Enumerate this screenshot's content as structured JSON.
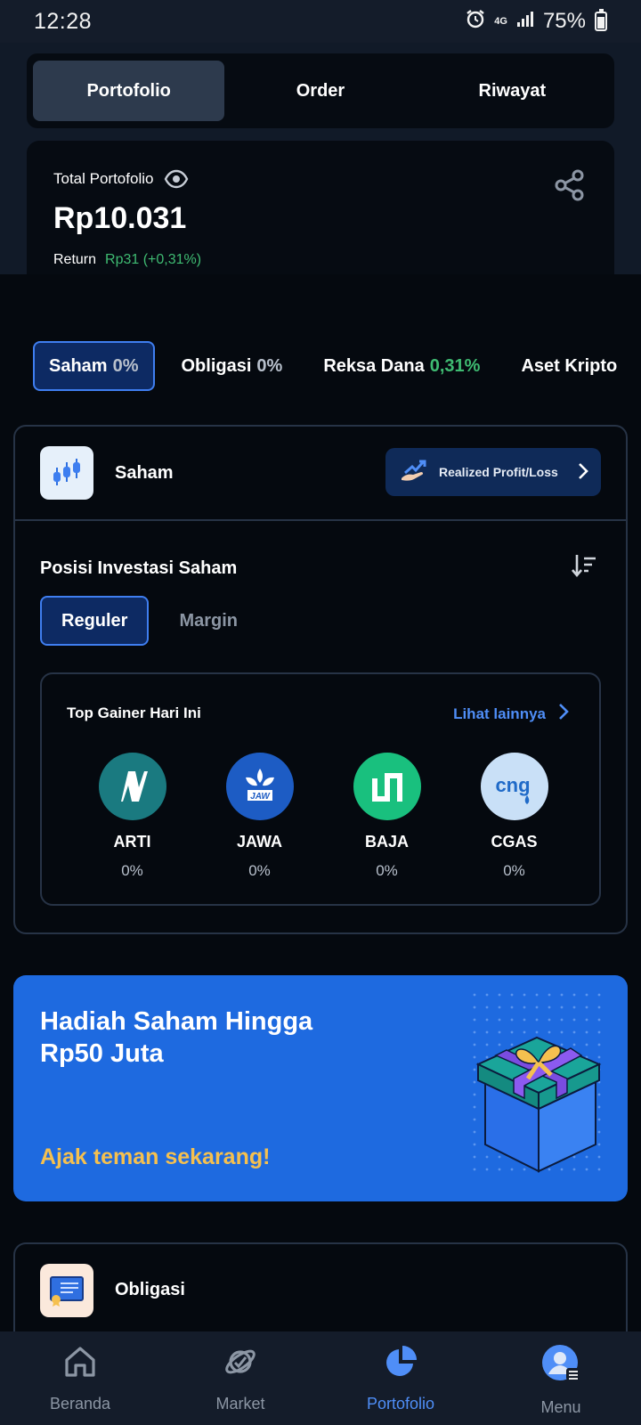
{
  "status_bar": {
    "time": "12:28",
    "network": "4G",
    "battery": "75%",
    "battery_level": 0.75
  },
  "top_tabs": [
    {
      "label": "Portofolio",
      "active": true
    },
    {
      "label": "Order",
      "active": false
    },
    {
      "label": "Riwayat",
      "active": false
    }
  ],
  "portfolio": {
    "total_label": "Total Portofolio",
    "total_value": "Rp10.031",
    "return_label": "Return",
    "return_value": "Rp31 (+0,31%)"
  },
  "asset_chips": [
    {
      "label": "Saham",
      "pct": "0%",
      "active": true
    },
    {
      "label": "Obligasi",
      "pct": "0%",
      "active": false
    },
    {
      "label": "Reksa Dana",
      "pct": "0,31%",
      "active": false
    },
    {
      "label": "Aset Kripto",
      "pct": "",
      "active": false
    }
  ],
  "saham": {
    "title": "Saham",
    "rpl_button": "Realized Profit/Loss",
    "posisi_title": "Posisi Investasi Saham",
    "sub_tabs": [
      {
        "label": "Reguler",
        "active": true
      },
      {
        "label": "Margin",
        "active": false
      }
    ],
    "gainer_title": "Top Gainer Hari Ini",
    "gainer_more": "Lihat lainnya",
    "gainers": [
      {
        "code": "ARTI",
        "pct": "0%",
        "logo_color": "#1a7a80"
      },
      {
        "code": "JAWA",
        "pct": "0%",
        "logo_color": "#1d5cc4"
      },
      {
        "code": "BAJA",
        "pct": "0%",
        "logo_color": "#19c07e"
      },
      {
        "code": "CGAS",
        "pct": "0%",
        "logo_color": "#c9e0f7"
      }
    ]
  },
  "promo": {
    "title": "Hadiah Saham Hingga Rp50 Juta",
    "cta": "Ajak teman sekarang!"
  },
  "obligasi": {
    "title": "Obligasi"
  },
  "bottom_nav": [
    {
      "label": "Beranda",
      "icon": "home-icon",
      "active": false
    },
    {
      "label": "Market",
      "icon": "planet-icon",
      "active": false
    },
    {
      "label": "Portofolio",
      "icon": "pie-chart-icon",
      "active": true
    },
    {
      "label": "Menu",
      "icon": "user-menu-icon",
      "active": false
    }
  ],
  "colors": {
    "accent": "#4f8ef7",
    "positive": "#3fbb72",
    "promo_bg": "#1e6ae0",
    "promo_cta": "#f5c04f"
  }
}
